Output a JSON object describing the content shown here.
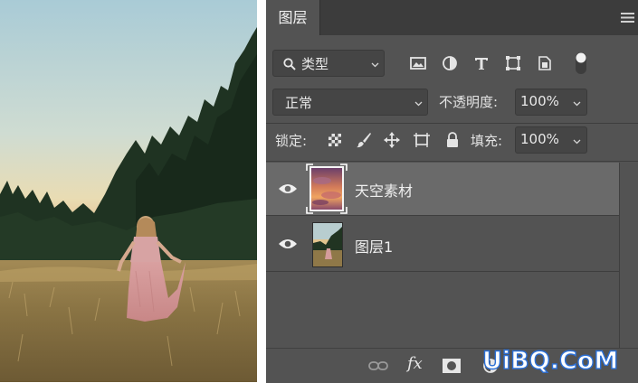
{
  "layers_panel": {
    "tab_label": "图层",
    "filter": {
      "kind_label": "类型"
    },
    "blend_mode": "正常",
    "opacity_label": "不透明度:",
    "opacity_value": "100%",
    "lock_label": "锁定:",
    "fill_label": "填充:",
    "fill_value": "100%",
    "layers": [
      {
        "name": "天空素材",
        "visible": true,
        "selected": true
      },
      {
        "name": "图层1",
        "visible": true,
        "selected": false
      }
    ],
    "bottom_fx_label": "fx"
  },
  "watermark": {
    "text": "UiBQ.CoM"
  },
  "colors": {
    "panel_bg": "#535353",
    "tabbar_bg": "#3c3c3c",
    "selected_row_bg": "#6a6a6a",
    "field_bg": "#454545",
    "watermark_stroke": "#2b6fd6"
  }
}
